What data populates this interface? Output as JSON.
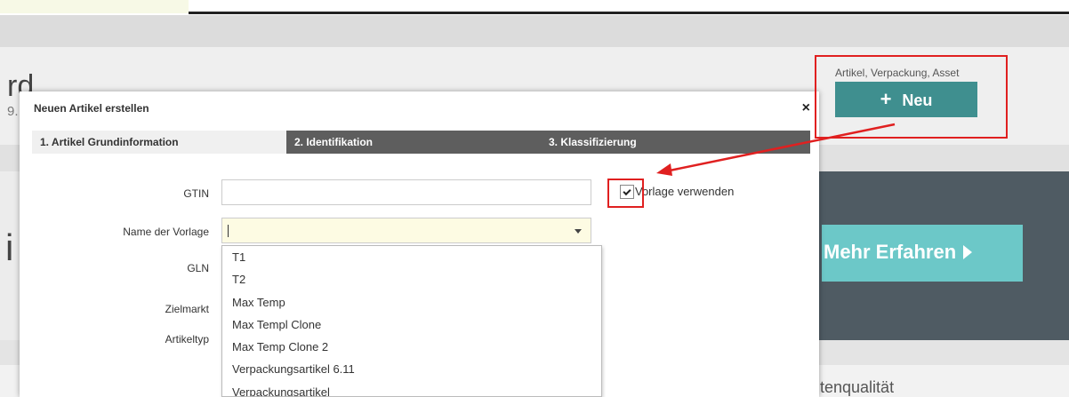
{
  "background": {
    "page_title": "rd",
    "page_subtitle": "9.",
    "hero_letter": "i",
    "mehr_button_label": "Mehr Erfahren",
    "lower_text": "tenqualität",
    "neu_caption": "Artikel, Verpackung, Asset",
    "neu_button_label": "Neu",
    "neu_plus": "+"
  },
  "modal": {
    "title": "Neuen Artikel erstellen",
    "close_glyph": "×",
    "tabs": [
      {
        "label": "1. Artikel Grundinformation"
      },
      {
        "label": "2. Identifikation"
      },
      {
        "label": "3. Klassifizierung"
      }
    ],
    "fields": {
      "gtin_label": "GTIN",
      "gtin_value": "",
      "vorlage_label": "Name der Vorlage",
      "gln_label": "GLN",
      "zielmarkt_label": "Zielmarkt",
      "artikeltyp_label": "Artikeltyp"
    },
    "checkbox": {
      "label": "Vorlage verwenden",
      "checked": true
    },
    "dropdown_options": [
      "T1",
      "T2",
      "Max Temp",
      "Max Templ Clone",
      "Max Temp Clone 2",
      "Verpackungsartikel 6.11",
      "Verpackungsartikel"
    ]
  },
  "colors": {
    "accent": "#3f8f8f",
    "tab_inactive": "#5e5e5e",
    "annotation": "#e02020",
    "hero": "#4f5b63",
    "mehr_button": "#6cc8c8"
  }
}
